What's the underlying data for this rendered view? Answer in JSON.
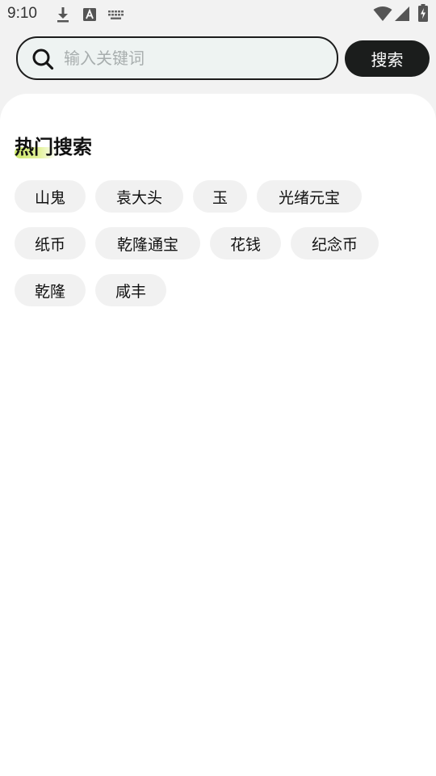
{
  "status_bar": {
    "time": "9:10",
    "icons": [
      "download-icon",
      "text-a-icon",
      "keyboard-icon",
      "wifi-icon",
      "cell-signal-icon",
      "battery-charging-icon"
    ]
  },
  "search": {
    "placeholder": "输入关键词",
    "value": "",
    "button_label": "搜索"
  },
  "hot_search": {
    "title": "热门搜索",
    "tags": [
      "山鬼",
      "袁大头",
      "玉",
      "光绪元宝",
      "纸币",
      "乾隆通宝",
      "花钱",
      "纪念币",
      "乾隆",
      "咸丰"
    ]
  },
  "colors": {
    "accent_dark": "#1b1d1c",
    "search_bg": "#eef3f2",
    "tag_bg": "#f1f1f1",
    "highlight": "#cde86a"
  }
}
